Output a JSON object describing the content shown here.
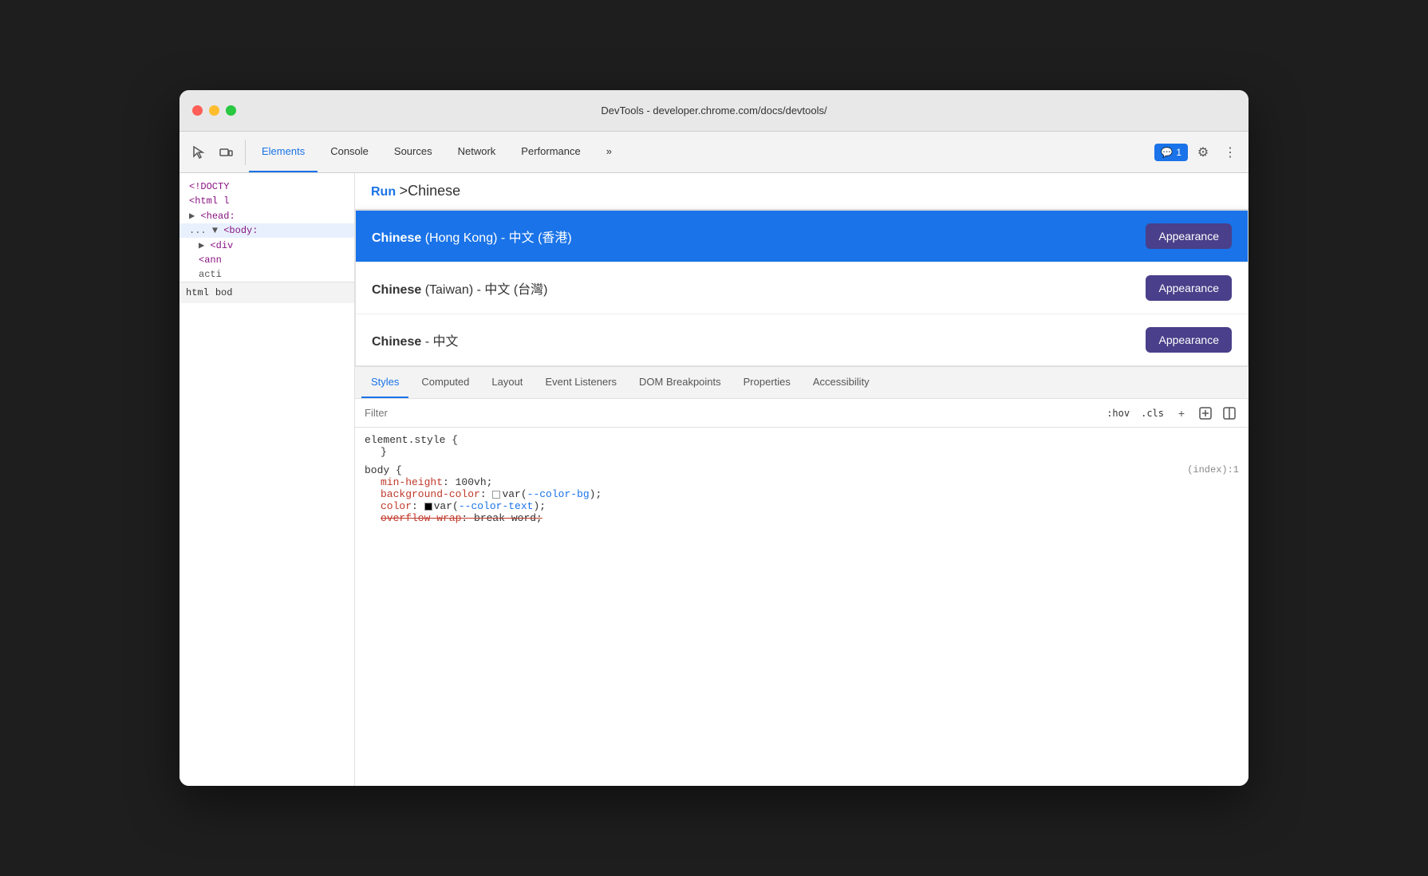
{
  "window": {
    "title": "DevTools - developer.chrome.com/docs/devtools/"
  },
  "toolbar": {
    "tabs": [
      {
        "label": "Elements",
        "active": true
      },
      {
        "label": "Console",
        "active": false
      },
      {
        "label": "Sources",
        "active": false
      },
      {
        "label": "Network",
        "active": false
      },
      {
        "label": "Performance",
        "active": false
      }
    ],
    "more_label": "»",
    "chat_badge": "1",
    "settings_icon": "⚙",
    "more_icon": "⋮"
  },
  "command_bar": {
    "run_label": "Run",
    "query": ">Chinese"
  },
  "autocomplete": {
    "items": [
      {
        "text_bold": "Chinese",
        "text_rest": " (Hong Kong) - 中文 (香港)",
        "button_label": "Appearance",
        "selected": true
      },
      {
        "text_bold": "Chinese",
        "text_rest": " (Taiwan) - 中文 (台灣)",
        "button_label": "Appearance",
        "selected": false
      },
      {
        "text_bold": "Chinese",
        "text_rest": " - 中文",
        "button_label": "Appearance",
        "selected": false
      }
    ]
  },
  "dom": {
    "lines": [
      {
        "text": "<!DOCTY",
        "type": "normal"
      },
      {
        "text": "<html l",
        "type": "tag"
      },
      {
        "text": "▶ <head:",
        "type": "tag"
      },
      {
        "text": "... ▼ <body:",
        "type": "tag",
        "ellipsis": true
      },
      {
        "text": "▶ <div",
        "type": "tag",
        "indent": 1
      },
      {
        "text": "<ann",
        "type": "tag",
        "indent": 1
      },
      {
        "text": "acti",
        "type": "normal",
        "indent": 1
      }
    ],
    "breadcrumbs": [
      "html",
      "bod"
    ]
  },
  "styles_tabs": [
    {
      "label": "Styles",
      "active": true
    },
    {
      "label": "Computed",
      "active": false
    },
    {
      "label": "Layout",
      "active": false
    },
    {
      "label": "Event Listeners",
      "active": false
    },
    {
      "label": "DOM Breakpoints",
      "active": false
    },
    {
      "label": "Properties",
      "active": false
    },
    {
      "label": "Accessibility",
      "active": false
    }
  ],
  "filter": {
    "placeholder": "Filter",
    "hov_label": ":hov",
    "cls_label": ".cls"
  },
  "styles_content": {
    "element_style": "element.style {",
    "body_rule": "body {",
    "file_ref": "(index):1",
    "properties": [
      {
        "prop": "min-height",
        "value": "100vh;"
      },
      {
        "prop": "background-color",
        "value": "var(--color-bg);",
        "has_swatch": true,
        "swatch_type": "white",
        "var_name": "--color-bg"
      },
      {
        "prop": "color",
        "value": "var(--color-text);",
        "has_swatch": true,
        "swatch_type": "black",
        "var_name": "--color-text"
      },
      {
        "prop": "overflow-wrap",
        "value": "break-word;",
        "strikethrough": true
      }
    ]
  }
}
